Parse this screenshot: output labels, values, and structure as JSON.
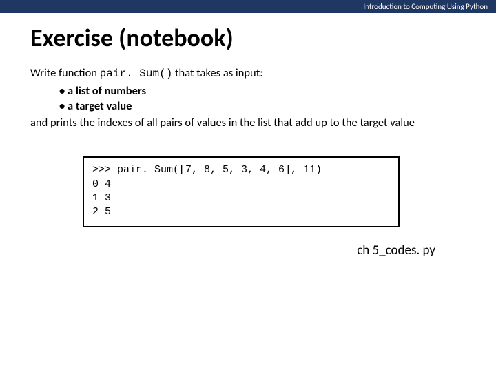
{
  "header": "Introduction to Computing Using Python",
  "title": "Exercise (notebook)",
  "intro_pre": "Write function ",
  "intro_fn": "pair. Sum()",
  "intro_post": " that takes as input:",
  "bullets": [
    "a list of numbers",
    "a target value"
  ],
  "intro_after": "and prints the indexes of all pairs of values in the list that add up to the target value",
  "code": ">>> pair. Sum([7, 8, 5, 3, 4, 6], 11)\n0 4\n1 3\n2 5",
  "footer": "ch 5_codes. py"
}
